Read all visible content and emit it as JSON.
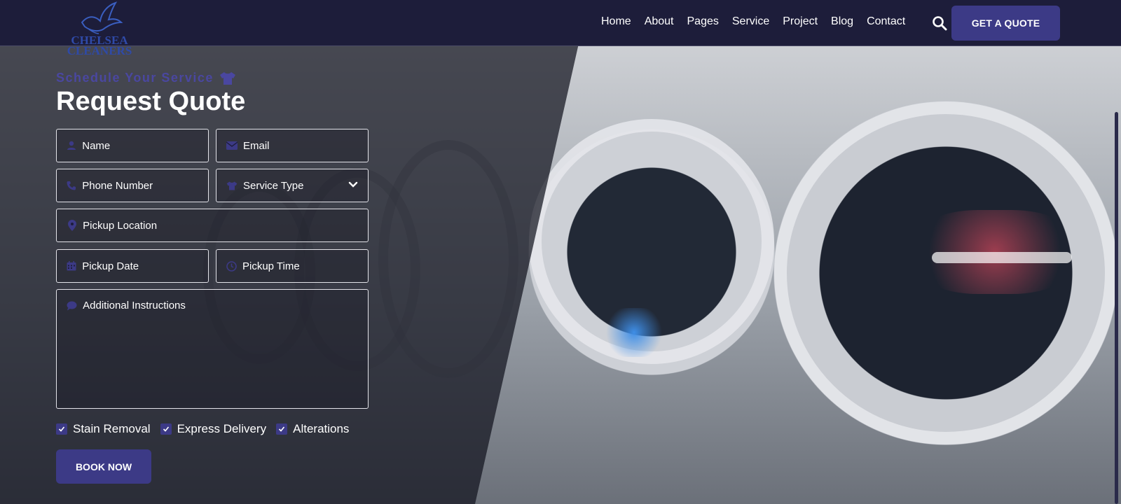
{
  "brand": {
    "logo_text": "CHELSEA CLEANERS",
    "logo_line1": "CHELSEA",
    "logo_line2": "CLEANERS"
  },
  "nav": {
    "items": [
      "Home",
      "About",
      "Pages",
      "Service",
      "Project",
      "Blog",
      "Contact"
    ],
    "cta_label": "GET A QUOTE"
  },
  "form": {
    "eyebrow": "Schedule Your Service",
    "title": "Request Quote",
    "fields": {
      "name": "Name",
      "email": "Email",
      "phone": "Phone Number",
      "service_type": "Service Type",
      "pickup_location": "Pickup Location",
      "pickup_date": "Pickup Date",
      "pickup_time": "Pickup Time",
      "instructions": "Additional Instructions"
    },
    "options": [
      {
        "label": "Stain Removal",
        "checked": true
      },
      {
        "label": "Express Delivery",
        "checked": true
      },
      {
        "label": "Alterations",
        "checked": true
      }
    ],
    "submit_label": "BOOK NOW"
  },
  "colors": {
    "header_bg": "#1d1d3a",
    "accent": "#3c3a86",
    "eyebrow": "#4a47a0"
  }
}
